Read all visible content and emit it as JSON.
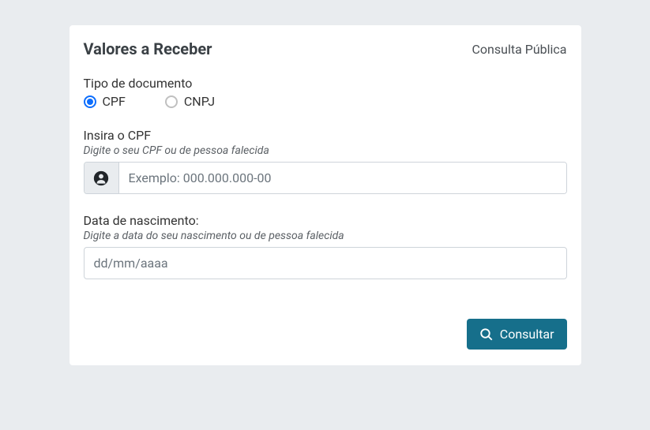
{
  "header": {
    "title": "Valores a Receber",
    "subtitle": "Consulta Pública"
  },
  "form": {
    "docType": {
      "label": "Tipo de documento",
      "options": {
        "cpf": "CPF",
        "cnpj": "CNPJ"
      },
      "selected": "cpf"
    },
    "cpfField": {
      "label": "Insira o CPF",
      "hint": "Digite o seu CPF ou de pessoa falecida",
      "placeholder": "Exemplo: 000.000.000-00",
      "value": ""
    },
    "birthField": {
      "label": "Data de nascimento:",
      "hint": "Digite a data do seu nascimento ou de pessoa falecida",
      "placeholder": "dd/mm/aaaa",
      "value": ""
    },
    "submit": {
      "label": "Consultar"
    }
  }
}
